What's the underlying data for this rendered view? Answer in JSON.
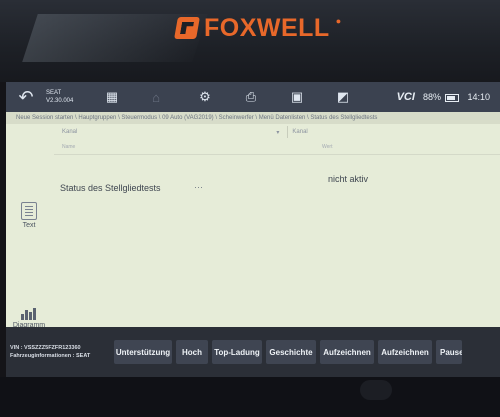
{
  "brand": {
    "name": "FOXWELL"
  },
  "toolbar": {
    "back_icon": "back-arrow-icon",
    "vehicle_make": "SEAT",
    "vehicle_version": "V2.30.004",
    "icons": [
      "home-icon",
      "settings-icon",
      "print-icon",
      "image-icon",
      "screenshot-icon"
    ],
    "vci_label": "VCI",
    "battery_percent": "88%",
    "time": "14:10"
  },
  "breadcrumb": "Neue Session starten \\ Hauptgruppen \\ Steuermodus \\ 09 Auto (VAG2019) \\ Scheinwerfer \\ Menü Datenlisten \\ Status des Stellgliedtests",
  "table": {
    "header_left": "Kanal",
    "header_right": "Kanal",
    "sub_left": "Name",
    "sub_right": "Wert"
  },
  "left_rail": {
    "text_label": "Text",
    "diagram_label": "Diagramm"
  },
  "row": {
    "label": "Status des Stellgliedtests",
    "dots": "···",
    "value": "nicht aktiv"
  },
  "bottom_bar": {
    "vin_line": "VIN : VSSZZZ5FZFR123360",
    "vehicle_info_line": "Fahrzeuginformationen : SEAT",
    "buttons": [
      "Unterstützung",
      "Hoch",
      "Top-Ladung",
      "Geschichte",
      "Aufzeichnen",
      "Aufzeichnen",
      "Pause"
    ]
  },
  "colors": {
    "brand_orange": "#e8682a",
    "toolbar_bg": "#3b4250",
    "content_bg": "#e6ecd8",
    "button_bg": "#3f4552"
  }
}
